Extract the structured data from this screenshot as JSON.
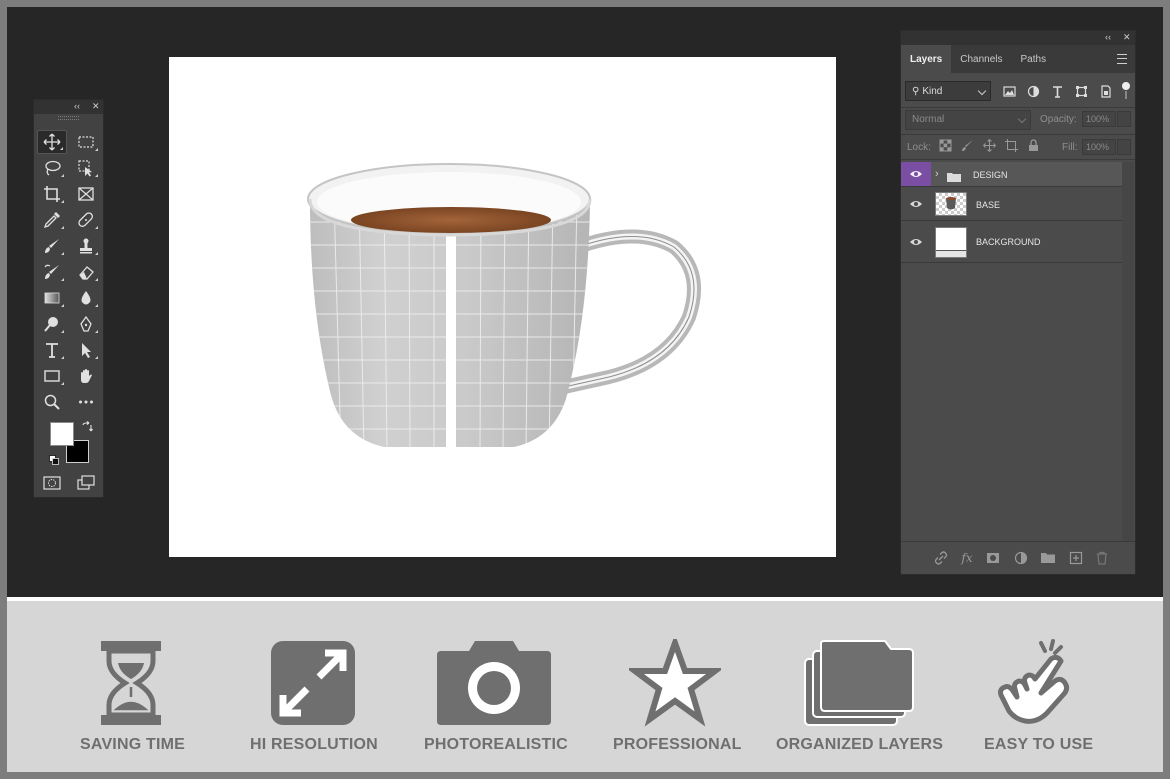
{
  "layers_panel": {
    "tabs": [
      {
        "label": "Layers",
        "active": true
      },
      {
        "label": "Channels",
        "active": false
      },
      {
        "label": "Paths",
        "active": false
      }
    ],
    "filter_kind": "Kind",
    "blend_mode": "Normal",
    "opacity_label": "Opacity:",
    "opacity_value": "100%",
    "lock_label": "Lock:",
    "fill_label": "Fill:",
    "fill_value": "100%",
    "layers": [
      {
        "name": "DESIGN",
        "type": "group",
        "selected": true
      },
      {
        "name": "BASE",
        "type": "smart-object"
      },
      {
        "name": "BACKGROUND",
        "type": "background"
      }
    ]
  },
  "tools": [
    "move-tool-icon",
    "marquee-tool-icon",
    "lasso-tool-icon",
    "quick-select-tool-icon",
    "crop-tool-icon",
    "frame-tool-icon",
    "eyedropper-tool-icon",
    "healing-brush-icon",
    "brush-tool-icon",
    "clone-stamp-icon",
    "history-brush-icon",
    "eraser-tool-icon",
    "gradient-tool-icon",
    "blur-tool-icon",
    "dodge-tool-icon",
    "pen-tool-icon",
    "type-tool-icon",
    "path-select-icon",
    "rectangle-tool-icon",
    "hand-tool-icon",
    "zoom-tool-icon",
    "more-tools-icon"
  ],
  "features": [
    {
      "label": "SAVING TIME",
      "icon": "hourglass-icon"
    },
    {
      "label": "HI RESOLUTION",
      "icon": "expand-arrows-icon"
    },
    {
      "label": "PHOTOREALISTIC",
      "icon": "camera-icon"
    },
    {
      "label": "PROFESSIONAL",
      "icon": "star-icon"
    },
    {
      "label": "ORGANIZED LAYERS",
      "icon": "folders-icon"
    },
    {
      "label": "EASY TO USE",
      "icon": "tap-hand-icon"
    }
  ],
  "colors": {
    "workspace": "#262626",
    "panel": "#4b4b4b",
    "selected_layer": "#7a4fa3",
    "feature_icon": "#6f6f6f",
    "feature_bg": "#d6d6d6"
  }
}
